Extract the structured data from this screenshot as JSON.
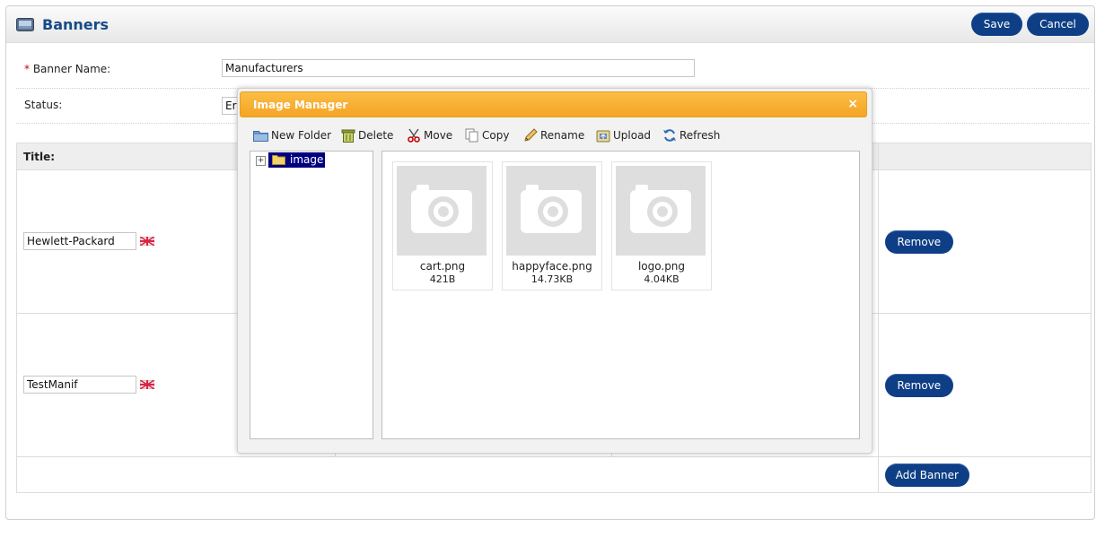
{
  "heading": {
    "title": "Banners",
    "save_label": "Save",
    "cancel_label": "Cancel"
  },
  "form": {
    "banner_name_required": "*",
    "banner_name_label": "Banner Name:",
    "banner_name_value": "Manufacturers",
    "status_label": "Status:",
    "status_value": "Er"
  },
  "grid": {
    "title_header": "Title:",
    "rows": [
      {
        "title_value": "Hewlett-Packard",
        "remove_label": "Remove"
      },
      {
        "title_value": "TestManif",
        "remove_label": "Remove"
      }
    ],
    "add_banner_label": "Add Banner"
  },
  "image_manager": {
    "title": "Image Manager",
    "close_glyph": "×",
    "toolbar": {
      "new_folder": "New Folder",
      "delete": "Delete",
      "move": "Move",
      "copy": "Copy",
      "rename": "Rename",
      "upload": "Upload",
      "refresh": "Refresh"
    },
    "tree": {
      "expander": "+",
      "root_folder": "image"
    },
    "files": [
      {
        "name": "cart.png",
        "size": "421B"
      },
      {
        "name": "happyface.png",
        "size": "14.73KB"
      },
      {
        "name": "logo.png",
        "size": "4.04KB"
      }
    ]
  },
  "colors": {
    "primary_button": "#0e3f86",
    "heading_text": "#184a87",
    "dialog_title": "#f5a425",
    "tree_selected": "#000080"
  }
}
